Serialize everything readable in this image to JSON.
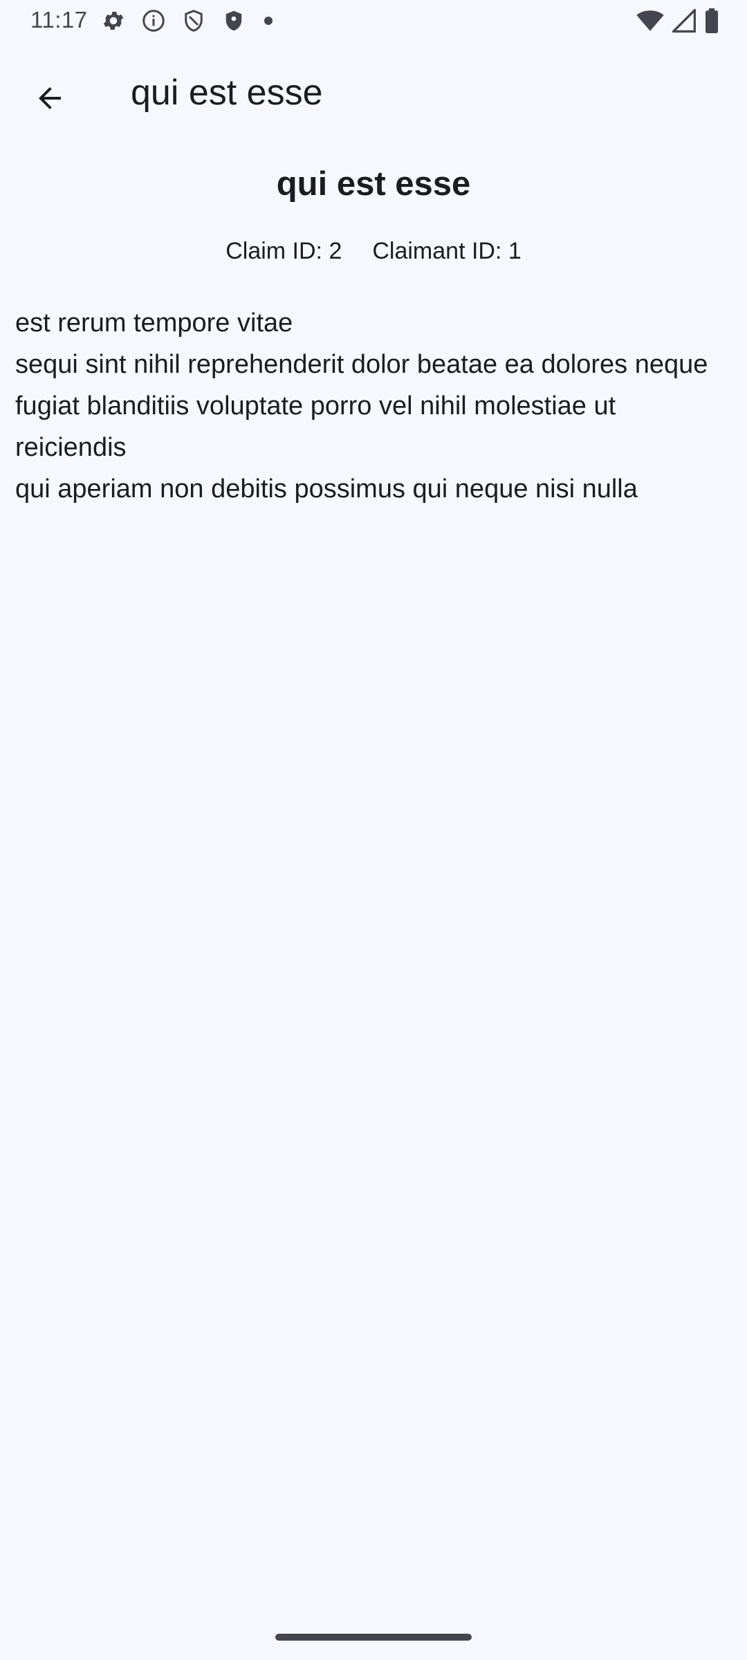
{
  "status_bar": {
    "time": "11:17",
    "left_icons": [
      "gear-icon",
      "info-icon",
      "shield-outline-icon",
      "shield-filled-icon",
      "dot-icon"
    ],
    "right_icons": [
      "wifi-icon",
      "signal-icon",
      "battery-icon"
    ]
  },
  "app_bar": {
    "back_icon": "arrow-back-icon",
    "title": "qui est esse"
  },
  "post": {
    "title": "qui est esse",
    "claim_id": "Claim ID: 2",
    "claimant_id": "Claimant ID: 1",
    "body": "est rerum tempore vitae\nsequi sint nihil reprehenderit dolor beatae ea dolores neque\nfugiat blanditiis voluptate porro vel nihil molestiae ut reiciendis\nqui aperiam non debitis possimus qui neque nisi nulla"
  },
  "colors": {
    "background": "#f7f8fd",
    "text": "#1b1c20",
    "status_text": "#44464f"
  }
}
